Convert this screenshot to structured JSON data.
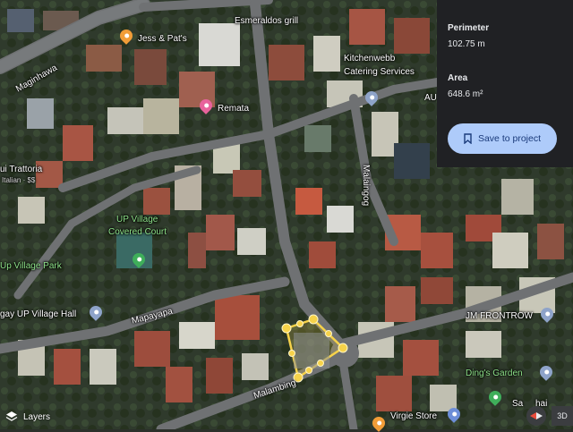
{
  "measure_panel": {
    "perimeter_label": "Perimeter",
    "perimeter_value": "102.75 m",
    "area_label": "Area",
    "area_value": "648.6 m²",
    "save_button_label": "Save to project"
  },
  "places": {
    "jess_pats": "Jess & Pat's",
    "esmeraldos": "Esmeraldos grill",
    "kitchenwebb_line1": "Kitchenwebb",
    "kitchenwebb_line2": "Catering Services",
    "remata": "Remata",
    "au": "AU",
    "trattoria": "ui Trattoria",
    "trattoria_sub": "Italian · $$",
    "covered_court_line1": "UP Village",
    "covered_court_line2": "Covered Court",
    "park": "Up Village Park",
    "hall": "gay UP Village Hall",
    "jm_frontrow": "JM FRONTROW",
    "dings_garden": "Ding's Garden",
    "virgie_store": "Virgie Store",
    "san": "Sa",
    "thar": "hai"
  },
  "roads": {
    "maginhawa": "Maginhawa",
    "malaingog": "Malaingog",
    "mapayapa": "Mapayapa",
    "malambing": "Malambing"
  },
  "controls": {
    "layers_label": "Layers",
    "threed_label": "3D"
  },
  "colors": {
    "polygon": "#f6d24a",
    "button_bg": "#aecbfa",
    "panel_bg": "#202124",
    "pin_orange": "#f29d38",
    "pin_pink": "#e8639c",
    "pin_green": "#3fae5a",
    "pin_gray": "#8ea3c9"
  }
}
